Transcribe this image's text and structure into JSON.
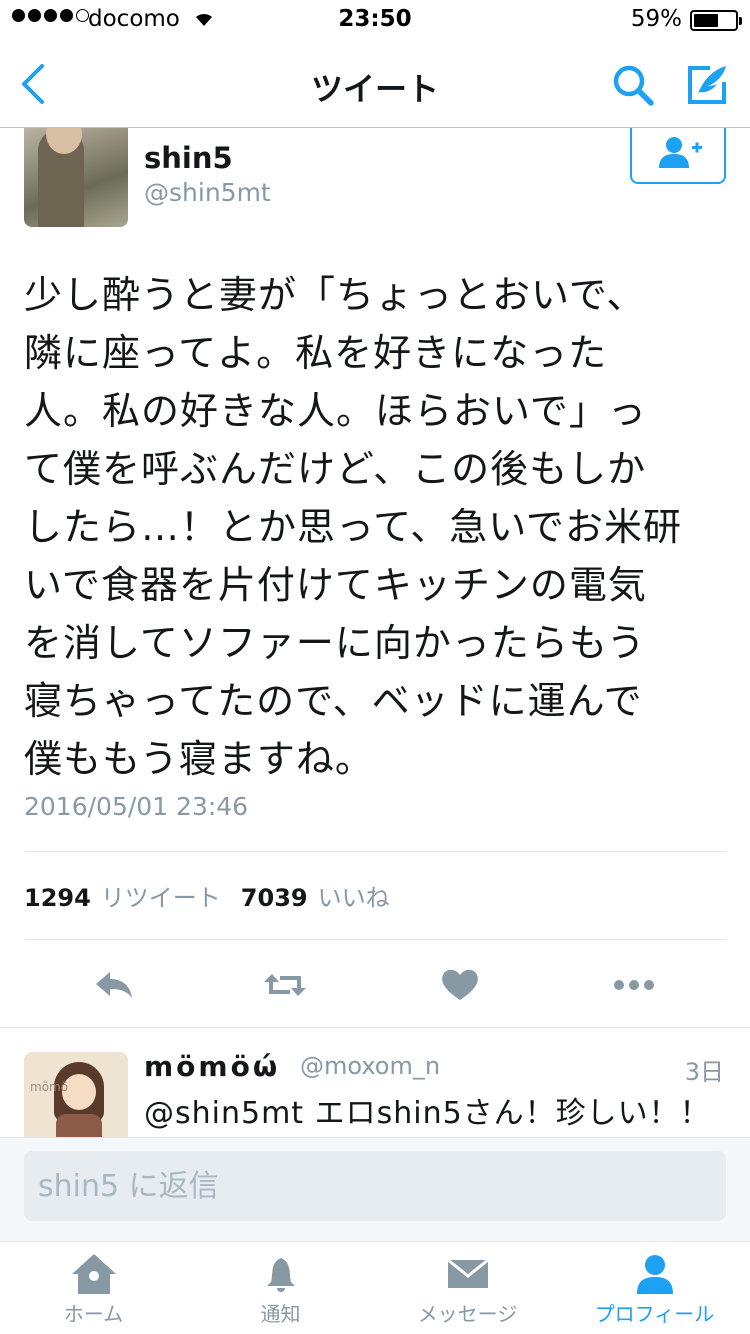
{
  "status_bar": {
    "carrier": "docomo",
    "time": "23:50",
    "battery": "59%",
    "battery_level": 0.59,
    "signal_dots_filled": 4,
    "signal_dots_total": 5
  },
  "nav": {
    "title": "ツイート",
    "back_icon": "chevron-left-icon",
    "search_icon": "search-icon",
    "compose_icon": "compose-icon"
  },
  "tweet": {
    "author_name": "shin5",
    "author_handle": "@shin5mt",
    "follow_icon": "add-user-icon",
    "text": "少し酔うと妻が「ちょっとおいで、\n隣に座ってよ。私を好きになった\n人。私の好きな人。ほらおいで」っ\nて僕を呼ぶんだけど、この後もしか\nしたら…！とか思って、急いでお米研\nいで食器を片付けてキッチンの電気\nを消してソファーに向かったらもう\n寝ちゃってたので、ベッドに運んで\n僕ももう寝ますね。",
    "timestamp": "2016/05/01 23:46",
    "retweet_count": "1294",
    "retweet_label": "リツイート",
    "like_count": "7039",
    "like_label": "いいね"
  },
  "actions": {
    "reply_icon": "reply-icon",
    "retweet_icon": "retweet-icon",
    "like_icon": "heart-icon",
    "more_icon": "more-icon"
  },
  "reply": {
    "name": "mömöώ",
    "handle": "@moxom_n",
    "time": "3日",
    "text": "@shin5mt エロshin5さん！珍しい！！"
  },
  "composer": {
    "placeholder": "shin5 に返信"
  },
  "tabs": [
    {
      "label": "ホーム",
      "icon": "home-icon",
      "active": false
    },
    {
      "label": "通知",
      "icon": "bell-icon",
      "active": false
    },
    {
      "label": "メッセージ",
      "icon": "envelope-icon",
      "active": false
    },
    {
      "label": "プロフィール",
      "icon": "person-icon",
      "active": true
    }
  ],
  "colors": {
    "accent": "#1da1f2",
    "secondary_text": "#8899a6",
    "icon_gray": "#8899a6"
  }
}
